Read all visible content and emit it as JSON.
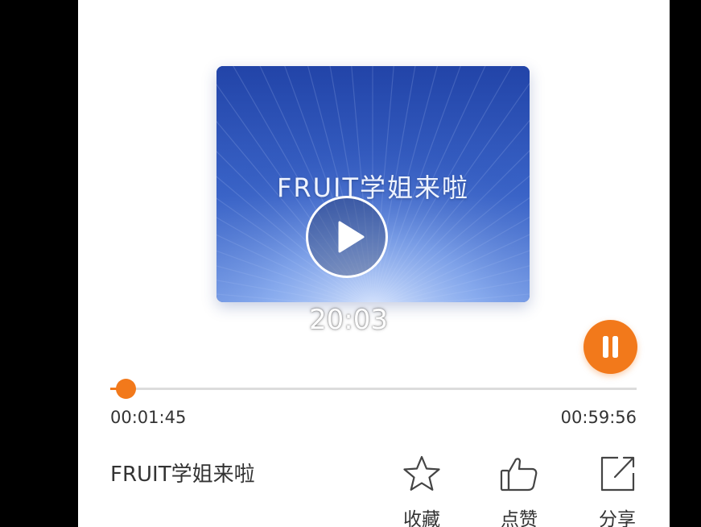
{
  "player": {
    "cover_title": "FRUIT学姐来啦",
    "duration_overlay": "20:03",
    "elapsed": "00:01:45",
    "total": "00:59:56",
    "progress": 0.029,
    "state": "playing"
  },
  "track": {
    "title": "FRUIT学姐来啦"
  },
  "actions": [
    {
      "label": "收藏",
      "icon": "star-icon"
    },
    {
      "label": "点赞",
      "icon": "thumbs-up-icon"
    },
    {
      "label": "分享",
      "icon": "share-icon"
    }
  ],
  "colors": {
    "accent": "#f2791b",
    "cover_blue": "#2d4fb0",
    "cover_light": "#b8d0ff"
  }
}
